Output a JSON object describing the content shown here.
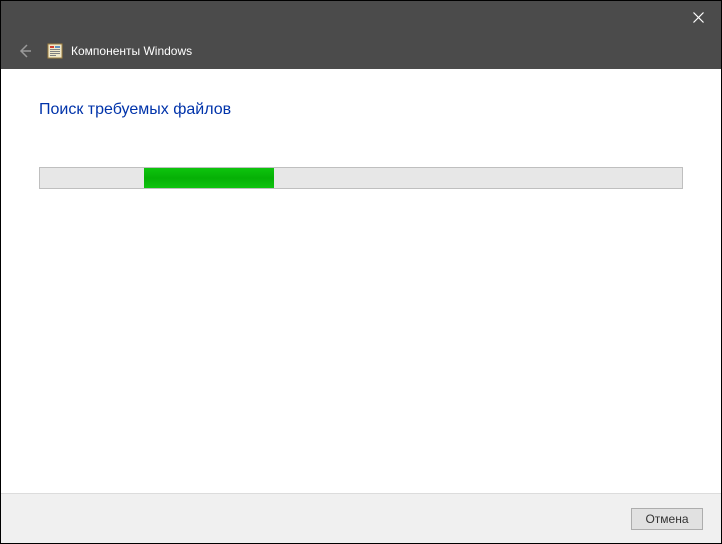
{
  "header": {
    "title": "Компоненты Windows"
  },
  "content": {
    "status_text": "Поиск требуемых файлов"
  },
  "footer": {
    "cancel_label": "Отмена"
  }
}
